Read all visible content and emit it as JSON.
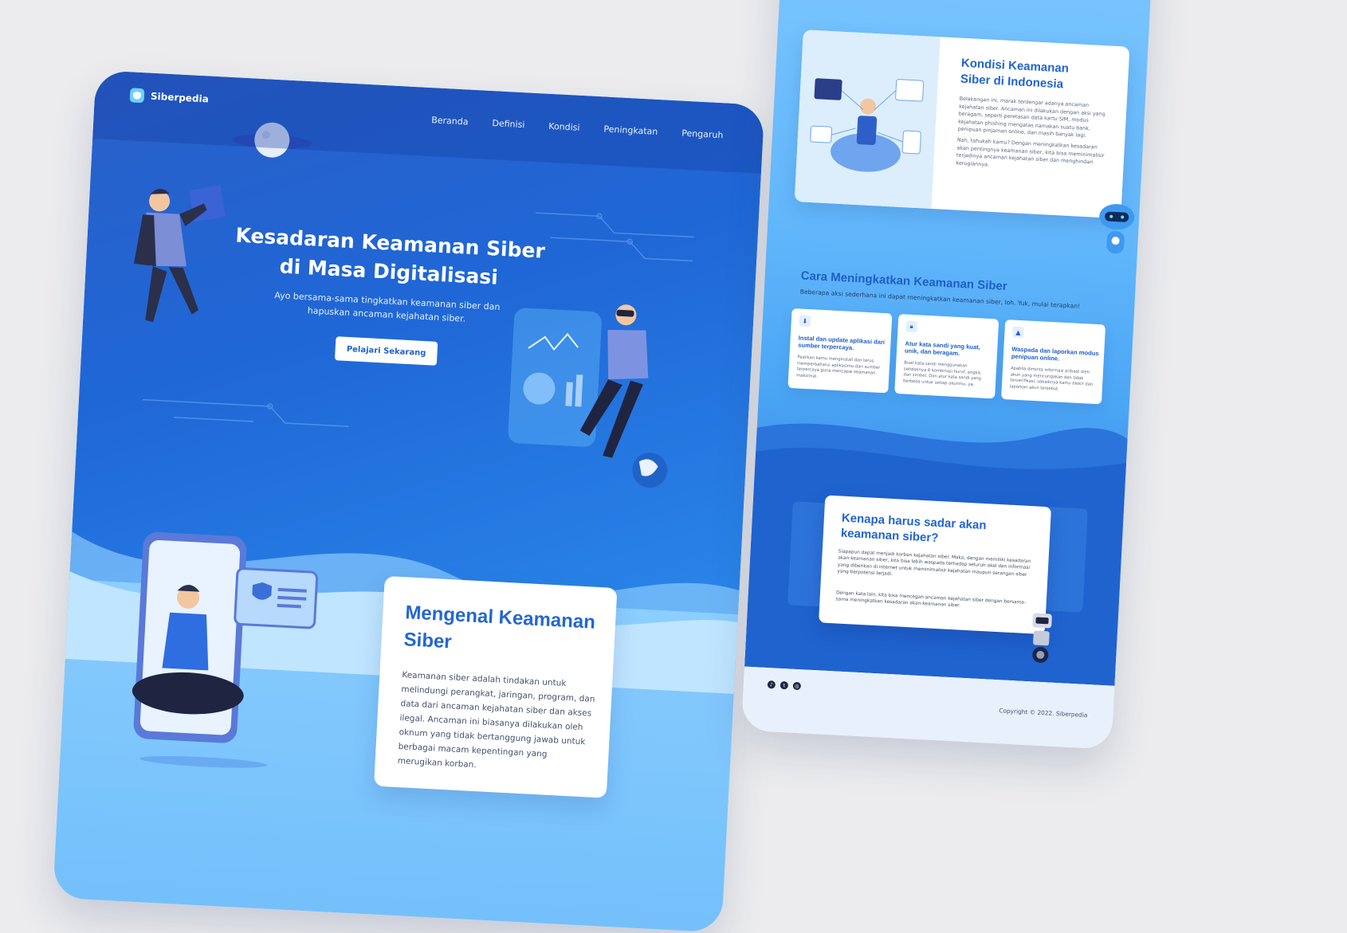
{
  "left": {
    "logo": "Siberpedia",
    "nav": [
      "Beranda",
      "Definisi",
      "Kondisi",
      "Peningkatan",
      "Pengaruh"
    ],
    "hero": {
      "title": "Kesadaran Keamanan Siber di Masa Digitalisasi",
      "subtitle": "Ayo bersama-sama tingkatkan keamanan siber dan hapuskan ancaman kejahatan siber.",
      "cta": "Pelajari Sekarang"
    },
    "mengenal": {
      "title": "Mengenal Keamanan Siber",
      "body": "Keamanan siber adalah tindakan untuk melindungi perangkat, jaringan, program, dan data dari ancaman kejahatan siber dan akses ilegal. Ancaman ini biasanya dilakukan oleh oknum yang tidak bertanggung jawab untuk berbagai macam kepentingan yang merugikan korban."
    }
  },
  "right": {
    "kondisi": {
      "title": "Kondisi Keamanan Siber di Indonesia",
      "p1": "Belakangan ini, marak terdengar adanya ancaman kejahatan siber. Ancaman ini dilakukan dengan aksi yang beragam, seperti peretasan data kartu SIM, modus kejahatan phishing mengatas namakan suatu bank, penipuan pinjaman online, dan masih banyak lagi.",
      "p2": "Nah, tahukah kamu? Dengan meningkatkan kesadaran akan pentingnya keamanan siber, kita bisa meminimalisir terjadinya ancaman kejahatan siber dan menghindari kerugiannya."
    },
    "cara": {
      "title": "Cara Meningkatkan Keamanan Siber",
      "subtitle": "Beberapa aksi sederhana ini dapat meningkatkan keamanan siber, loh. Yuk, mulai terapkan!",
      "tips": [
        {
          "icon": "download-icon",
          "title": "Instal dan update aplikasi dari sumber terpercaya.",
          "body": "Pastikan kamu menginstall dan terus memperbaharui aplikasimu dari sumber terpercaya guna mencapai keamanan maksimal."
        },
        {
          "icon": "lock-icon",
          "title": "Atur kata sandi yang kuat, unik, dan beragam.",
          "body": "Buat kata sandi menggunakan setidaknya 8 kombinasi huruf, angka, dan simbol. Dan atur kata sandi yang berbeda untuk setiap akunmu, ya."
        },
        {
          "icon": "warning-icon",
          "title": "Waspada dan laporkan modus penipuan online.",
          "body": "Apabila diminta informasi pribadi oleh akun yang mencurigakan dan tidak terverifikasi, sebaiknya kamu blokir dan laporkan akun tersebut."
        }
      ]
    },
    "kenapa": {
      "title": "Kenapa harus sadar akan keamanan siber?",
      "p1": "Siapapun dapat menjadi korban kejahatan siber. Maka, dengan memiliki kesadaran akan keamanan siber, kita bisa lebih waspada terhadap seluruh akel dan informasi yang diberikan di internet untuk meminimalisir kejahatan maupun serangan siber yang berpotensi terjadi.",
      "p2": "Dengan kata lain, kita bisa mencegah ancaman kejahatan siber dengan bersama-sama meningkatkan kesadaran akan keamanan siber."
    },
    "footer": {
      "social": [
        "tiktok-icon",
        "twitter-icon",
        "instagram-icon"
      ],
      "copyright": "Copyright © 2022. Siberpedia"
    }
  },
  "colors": {
    "primary": "#2264cf",
    "hero_dark": "#1f5ec7",
    "light_bg": "#c6e8ff"
  }
}
